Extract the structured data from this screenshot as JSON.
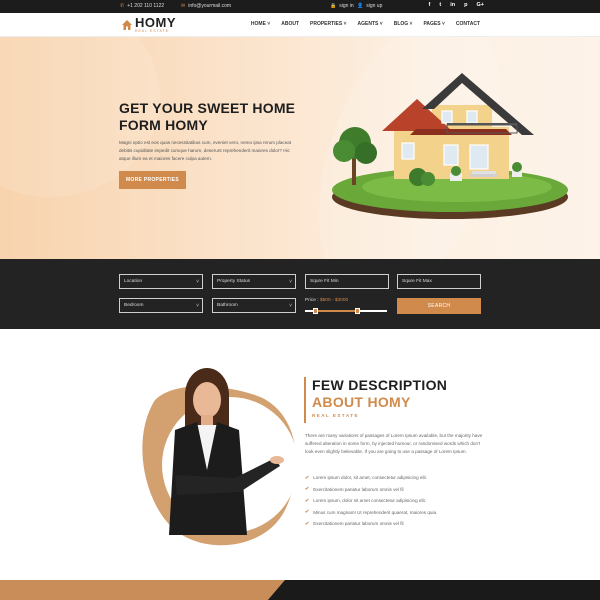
{
  "topbar": {
    "phone": "+1 202 110 1122",
    "email": "info@yourmail.com",
    "signin": "sign in",
    "signup": "sign up",
    "social": [
      "f",
      "t",
      "in",
      "p",
      "G+"
    ]
  },
  "logo": {
    "name": "HOMY",
    "tagline": "REAL ESTATE"
  },
  "nav": [
    "HOME",
    "ABOUT",
    "PROPERTIES",
    "AGENTS",
    "BLOG",
    "PAGES",
    "CONTACT"
  ],
  "hero": {
    "title_line1": "GET YOUR SWEET HOME",
    "title_line2": "FORM HOMY",
    "text": "Magni optio est eos quas necessitatibus cum, eveniet vero, nemo ipsa rerum placeat debitis cupiditate impedit cumque harum, deserunt reprehenderit maiores dolor? Hic atque illum ea et maiores facere culpa autem.",
    "button": "MORE PROPERTIES"
  },
  "search": {
    "location": "Location",
    "status": "Property Status",
    "sqft_min": "Squre Fit Min",
    "sqft_max": "Squre Fit Max",
    "bedroom": "Bedroom",
    "bathroom": "Bathroom",
    "price_prefix": "Price :",
    "price_value": "$500 - $3000",
    "price_range": [
      500,
      3000
    ],
    "button": "SEARCH"
  },
  "about": {
    "title1": "FEW DESCRIPTION",
    "title2": "ABOUT HOMY",
    "subtitle": "REAL ESTATE",
    "text": "There are many variations of passages of Lorem Ipsum available, but the majority have suffered alteration in some form, by injected humour, or randomised words which don't look even slightly believable. If you are going to use a passage of Lorem Ipsum.",
    "list": [
      "Lorem ipsum dolor, sit amet, consectetur adipisicing elit.",
      "Exercitationem pariatur laborum omnis vel fil",
      "Lorem ipsum, dolor sit amet consectetur adipisicing elit.",
      "Minus cum magnam! Ut reprehenderit quaerat, maiores quia.",
      "Exercitationem pariatur laborum omnis vel fil"
    ]
  },
  "colors": {
    "accent": "#d08a4c",
    "dark": "#232323"
  }
}
